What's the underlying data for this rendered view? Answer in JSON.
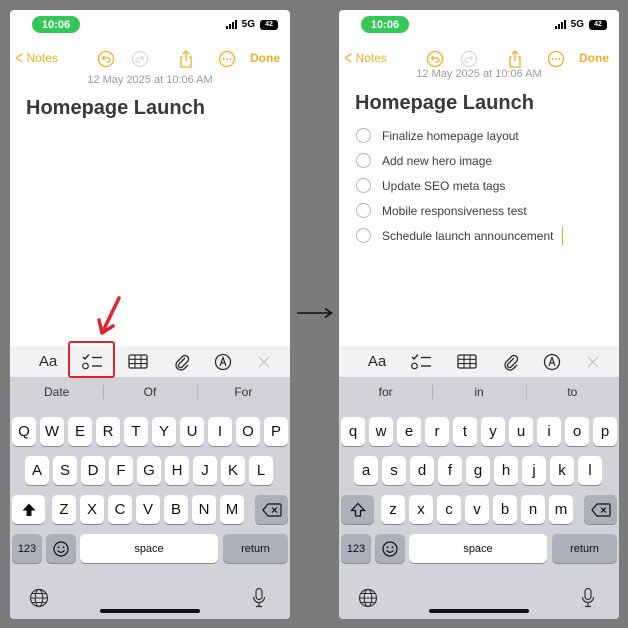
{
  "colors": {
    "accent": "#e5b12e",
    "status_green": "#34c759",
    "highlight_red": "#e0232e"
  },
  "transition_arrow": "→",
  "screens": [
    {
      "status": {
        "time": "10:06",
        "network": "5G",
        "battery": "42"
      },
      "nav": {
        "back_label": "Notes",
        "done_label": "Done",
        "icons": [
          "undo-icon",
          "redo-icon",
          "share-icon",
          "more-icon"
        ]
      },
      "note": {
        "timestamp": "12 May 2025 at 10:06 AM",
        "title": "Homepage Launch",
        "checklist": []
      },
      "toolbar": {
        "aa_label": "Aa",
        "icons": [
          "format-text-icon",
          "checklist-icon",
          "table-icon",
          "attachment-icon",
          "markup-icon",
          "close-icon"
        ],
        "highlighted": "checklist-icon"
      },
      "keyboard": {
        "suggestions": [
          "Date",
          "Of",
          "For"
        ],
        "row1": [
          "Q",
          "W",
          "E",
          "R",
          "T",
          "Y",
          "U",
          "I",
          "O",
          "P"
        ],
        "row2": [
          "A",
          "S",
          "D",
          "F",
          "G",
          "H",
          "J",
          "K",
          "L"
        ],
        "row3": [
          "Z",
          "X",
          "C",
          "V",
          "B",
          "N",
          "M"
        ],
        "numbers_label": "123",
        "space_label": "space",
        "return_label": "return",
        "shift_active": true
      }
    },
    {
      "status": {
        "time": "10:06",
        "network": "5G",
        "battery": "42"
      },
      "nav": {
        "back_label": "Notes",
        "done_label": "Done",
        "icons": [
          "undo-icon",
          "redo-icon",
          "share-icon",
          "more-icon"
        ]
      },
      "note": {
        "timestamp": "12 May 2025 at 10:06 AM",
        "title": "Homepage Launch",
        "checklist": [
          {
            "text": "Finalize homepage layout",
            "checked": false
          },
          {
            "text": "Add new hero image",
            "checked": false
          },
          {
            "text": "Update SEO meta tags",
            "checked": false
          },
          {
            "text": "Mobile responsiveness test",
            "checked": false
          },
          {
            "text": "Schedule launch announcement",
            "checked": false
          }
        ]
      },
      "toolbar": {
        "aa_label": "Aa",
        "icons": [
          "format-text-icon",
          "checklist-icon",
          "table-icon",
          "attachment-icon",
          "markup-icon",
          "close-icon"
        ]
      },
      "keyboard": {
        "suggestions": [
          "for",
          "in",
          "to"
        ],
        "row1": [
          "q",
          "w",
          "e",
          "r",
          "t",
          "y",
          "u",
          "i",
          "o",
          "p"
        ],
        "row2": [
          "a",
          "s",
          "d",
          "f",
          "g",
          "h",
          "j",
          "k",
          "l"
        ],
        "row3": [
          "z",
          "x",
          "c",
          "v",
          "b",
          "n",
          "m"
        ],
        "numbers_label": "123",
        "space_label": "space",
        "return_label": "return",
        "shift_active": false
      }
    }
  ]
}
